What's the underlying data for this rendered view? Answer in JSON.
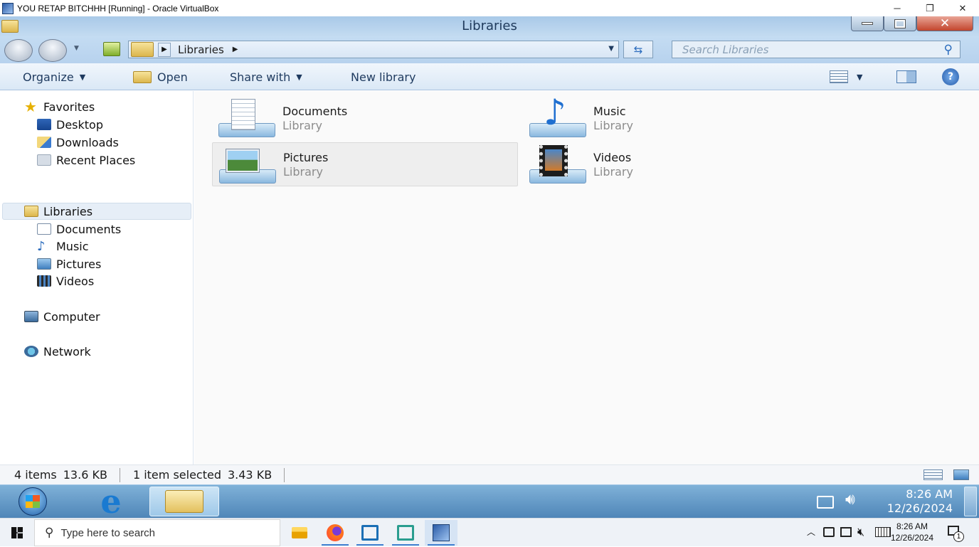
{
  "vbox": {
    "title": "YOU RETAP BITCHHH [Running] - Oracle VirtualBox",
    "min": "─",
    "restore": "❐",
    "close": "✕"
  },
  "explorer": {
    "title": "Libraries",
    "address": {
      "crumb": "Libraries"
    },
    "search_placeholder": "Search Libraries",
    "toolbar": {
      "organize": "Organize",
      "open": "Open",
      "share_with": "Share with",
      "new_library": "New library"
    },
    "nav": {
      "favorites": "Favorites",
      "fav_items": [
        "Desktop",
        "Downloads",
        "Recent Places"
      ],
      "libraries": "Libraries",
      "lib_items": [
        "Documents",
        "Music",
        "Pictures",
        "Videos"
      ],
      "computer": "Computer",
      "network": "Network"
    },
    "tiles": [
      {
        "name": "Documents",
        "sub": "Library"
      },
      {
        "name": "Music",
        "sub": "Library"
      },
      {
        "name": "Pictures",
        "sub": "Library"
      },
      {
        "name": "Videos",
        "sub": "Library"
      }
    ],
    "status": {
      "items": "4 items",
      "size": "13.6 KB",
      "selected": "1 item selected",
      "sel_size": "3.43 KB"
    }
  },
  "win7_taskbar": {
    "time": "8:26 AM",
    "date": "12/26/2024"
  },
  "host_taskbar": {
    "search_placeholder": "Type here to search",
    "time": "8:26 AM",
    "date": "12/26/2024",
    "notif_count": "1"
  }
}
